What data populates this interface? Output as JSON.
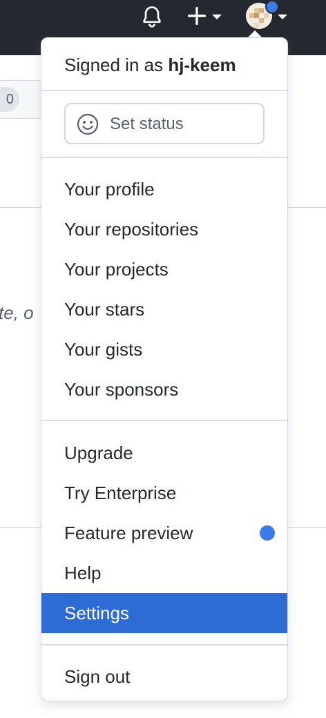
{
  "header": {
    "icons": [
      "bell-icon",
      "plus-icon",
      "chevron-down-icon",
      "avatar",
      "notification-dot"
    ]
  },
  "background": {
    "count_badge": "0",
    "partial_text": "te, o"
  },
  "menu": {
    "signed_in_prefix": "Signed in as ",
    "username": "hj-keem",
    "status_label": "Set status",
    "section1": [
      "Your profile",
      "Your repositories",
      "Your projects",
      "Your stars",
      "Your gists",
      "Your sponsors"
    ],
    "section2": [
      "Upgrade",
      "Try Enterprise",
      "Feature preview",
      "Help",
      "Settings"
    ],
    "sign_out": "Sign out",
    "active_item": "Settings"
  },
  "colors": {
    "header_bg": "#24292f",
    "accent": "#2d6bd5",
    "dot": "#3b7bea",
    "text": "#24292f"
  }
}
